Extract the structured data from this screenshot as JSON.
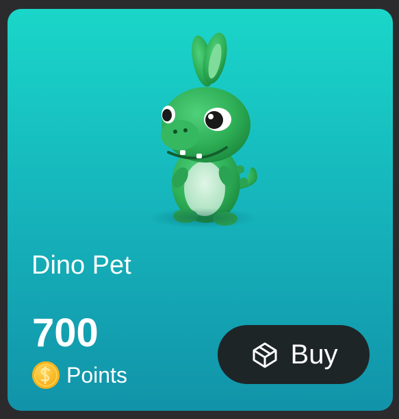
{
  "product": {
    "name": "Dino Pet",
    "image_icon": "dinosaur-pet-icon"
  },
  "price": {
    "amount": "700",
    "unit": "Points",
    "currency_icon": "coin-icon"
  },
  "buy_button": {
    "label": "Buy",
    "icon": "box-icon"
  },
  "colors": {
    "card_top": "#1ad6c9",
    "card_bottom": "#1193a9",
    "button_bg": "#1e2527",
    "coin": "#f7b624",
    "dino": "#2fb057"
  }
}
